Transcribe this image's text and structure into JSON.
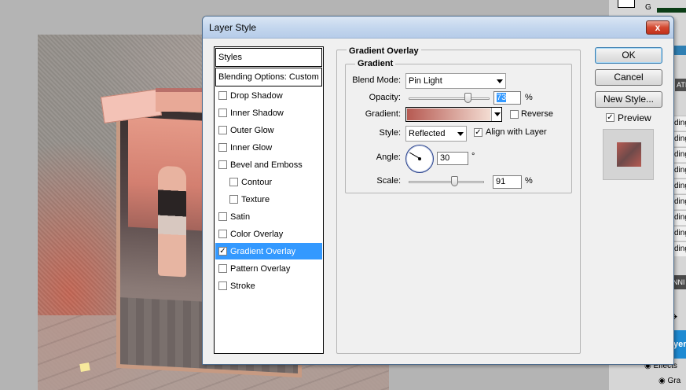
{
  "dialog": {
    "title": "Layer Style",
    "close_label": "x"
  },
  "styles_list": {
    "header": "Styles",
    "blending": "Blending Options: Custom",
    "items": [
      {
        "label": "Drop Shadow",
        "checked": false
      },
      {
        "label": "Inner Shadow",
        "checked": false
      },
      {
        "label": "Outer Glow",
        "checked": false
      },
      {
        "label": "Inner Glow",
        "checked": false
      },
      {
        "label": "Bevel and Emboss",
        "checked": false
      },
      {
        "label": "Contour",
        "checked": false
      },
      {
        "label": "Texture",
        "checked": false
      },
      {
        "label": "Satin",
        "checked": false
      },
      {
        "label": "Color Overlay",
        "checked": false
      },
      {
        "label": "Gradient Overlay",
        "checked": true,
        "selected": true
      },
      {
        "label": "Pattern Overlay",
        "checked": false
      },
      {
        "label": "Stroke",
        "checked": false
      }
    ],
    "check_mark": "✓"
  },
  "gradient_overlay": {
    "section_title": "Gradient Overlay",
    "group_title": "Gradient",
    "blend_mode_label": "Blend Mode:",
    "blend_mode_value": "Pin Light",
    "opacity_label": "Opacity:",
    "opacity_value": "73",
    "opacity_fraction": 0.73,
    "percent": "%",
    "gradient_label": "Gradient:",
    "gradient_start_color": "#b65a52",
    "gradient_end_color": "#f3dcd2",
    "reverse_label": "Reverse",
    "reverse_checked": false,
    "style_label": "Style:",
    "style_value": "Reflected",
    "align_label": "Align with Layer",
    "align_checked": true,
    "angle_label": "Angle:",
    "angle_value": "30",
    "degree": "°",
    "scale_label": "Scale:",
    "scale_value": "91",
    "scale_fraction": 0.91
  },
  "buttons": {
    "ok": "OK",
    "cancel": "Cancel",
    "new_style": "New Style...",
    "preview_label": "Preview",
    "preview_checked": true
  },
  "right_panel": {
    "channel_label": "G",
    "rows": [
      "dings",
      "ding",
      "dings",
      "ding",
      "dings",
      "ding",
      "ding",
      "ding",
      "ding"
    ],
    "tab_label": "ATIO",
    "dark_bar_label": "NNI",
    "selected_row": "yer",
    "effects_label": "Effects",
    "gradient_row": "Gra"
  },
  "colors": {
    "selection_blue": "#3399ff",
    "title_gradient_top": "#dbe6f4",
    "close_red": "#d3472f"
  }
}
